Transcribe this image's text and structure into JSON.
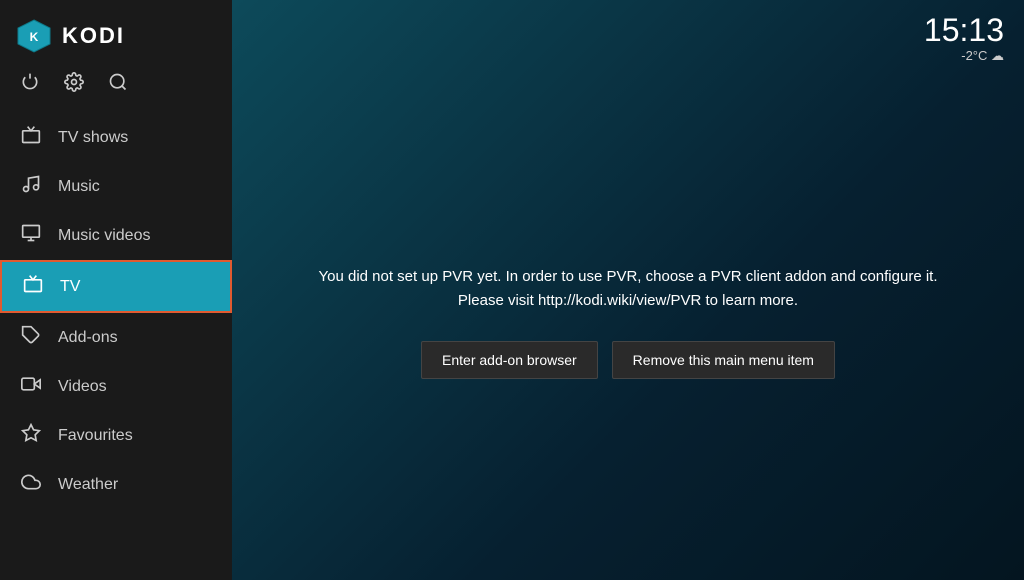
{
  "sidebar": {
    "app_name": "KODI",
    "icons": {
      "power": "⏻",
      "settings": "⚙",
      "search": "🔍"
    },
    "nav_items": [
      {
        "id": "tv-shows",
        "label": "TV shows",
        "icon": "tv"
      },
      {
        "id": "music",
        "label": "Music",
        "icon": "music"
      },
      {
        "id": "music-videos",
        "label": "Music videos",
        "icon": "music-video"
      },
      {
        "id": "tv",
        "label": "TV",
        "icon": "tv-live",
        "active": true
      },
      {
        "id": "add-ons",
        "label": "Add-ons",
        "icon": "addon"
      },
      {
        "id": "videos",
        "label": "Videos",
        "icon": "video"
      },
      {
        "id": "favourites",
        "label": "Favourites",
        "icon": "star"
      },
      {
        "id": "weather",
        "label": "Weather",
        "icon": "weather"
      }
    ]
  },
  "topbar": {
    "time": "15:13",
    "weather": "-2°C ☁"
  },
  "main": {
    "pvr_message_line1": "You did not set up PVR yet. In order to use PVR, choose a PVR client addon and configure it.",
    "pvr_message_line2": "Please visit http://kodi.wiki/view/PVR to learn more.",
    "btn_addon_browser": "Enter add-on browser",
    "btn_remove_menu": "Remove this main menu item"
  }
}
